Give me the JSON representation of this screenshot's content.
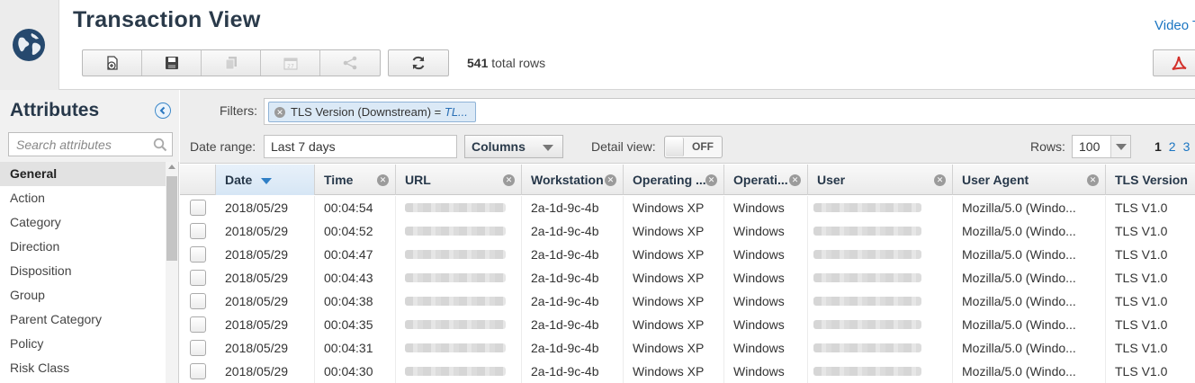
{
  "header": {
    "title": "Transaction View",
    "video_link": "Video T",
    "total_rows_count": "541",
    "total_rows_suffix": " total rows"
  },
  "toolbar": {
    "buttons": [
      {
        "icon": "add-report-icon",
        "enabled": true
      },
      {
        "icon": "save-icon",
        "enabled": true
      },
      {
        "icon": "copy-icon",
        "enabled": false
      },
      {
        "icon": "schedule-icon",
        "enabled": false
      },
      {
        "icon": "share-icon",
        "enabled": false
      }
    ],
    "refresh_icon": "refresh-icon",
    "pdf_icon": "pdf-icon"
  },
  "sidebar": {
    "title": "Attributes",
    "search_placeholder": "Search attributes",
    "items": [
      "General",
      "Action",
      "Category",
      "Direction",
      "Disposition",
      "Group",
      "Parent Category",
      "Policy",
      "Risk Class"
    ]
  },
  "filters": {
    "label": "Filters:",
    "chip_name": "TLS Version (Downstream) = ",
    "chip_value": "TL..."
  },
  "controls": {
    "date_label": "Date range:",
    "date_value": "Last 7 days",
    "columns_label": "Columns",
    "detail_label": "Detail view:",
    "detail_state": "OFF",
    "rows_label": "Rows:",
    "rows_value": "100",
    "pages": [
      "1",
      "2",
      "3"
    ]
  },
  "table": {
    "headers": [
      "Date",
      "Time",
      "URL",
      "Workstation",
      "Operating ...",
      "Operati...",
      "User",
      "User Agent",
      "TLS Version"
    ],
    "rows": [
      {
        "date": "2018/05/29",
        "time": "00:04:54",
        "workstation": "2a-1d-9c-4b",
        "os": "Windows XP",
        "os_family": "Windows",
        "agent": "Mozilla/5.0 (Windo...",
        "tls": "TLS V1.0"
      },
      {
        "date": "2018/05/29",
        "time": "00:04:52",
        "workstation": "2a-1d-9c-4b",
        "os": "Windows XP",
        "os_family": "Windows",
        "agent": "Mozilla/5.0 (Windo...",
        "tls": "TLS V1.0"
      },
      {
        "date": "2018/05/29",
        "time": "00:04:47",
        "workstation": "2a-1d-9c-4b",
        "os": "Windows XP",
        "os_family": "Windows",
        "agent": "Mozilla/5.0 (Windo...",
        "tls": "TLS V1.0"
      },
      {
        "date": "2018/05/29",
        "time": "00:04:43",
        "workstation": "2a-1d-9c-4b",
        "os": "Windows XP",
        "os_family": "Windows",
        "agent": "Mozilla/5.0 (Windo...",
        "tls": "TLS V1.0"
      },
      {
        "date": "2018/05/29",
        "time": "00:04:38",
        "workstation": "2a-1d-9c-4b",
        "os": "Windows XP",
        "os_family": "Windows",
        "agent": "Mozilla/5.0 (Windo...",
        "tls": "TLS V1.0"
      },
      {
        "date": "2018/05/29",
        "time": "00:04:35",
        "workstation": "2a-1d-9c-4b",
        "os": "Windows XP",
        "os_family": "Windows",
        "agent": "Mozilla/5.0 (Windo...",
        "tls": "TLS V1.0"
      },
      {
        "date": "2018/05/29",
        "time": "00:04:31",
        "workstation": "2a-1d-9c-4b",
        "os": "Windows XP",
        "os_family": "Windows",
        "agent": "Mozilla/5.0 (Windo...",
        "tls": "TLS V1.0"
      },
      {
        "date": "2018/05/29",
        "time": "00:04:30",
        "workstation": "2a-1d-9c-4b",
        "os": "Windows XP",
        "os_family": "Windows",
        "agent": "Mozilla/5.0 (Windo...",
        "tls": "TLS V1.0"
      }
    ]
  },
  "colors": {
    "accent": "#1a75c2",
    "title": "#27384a",
    "chip_bg": "#dbe9f6"
  }
}
